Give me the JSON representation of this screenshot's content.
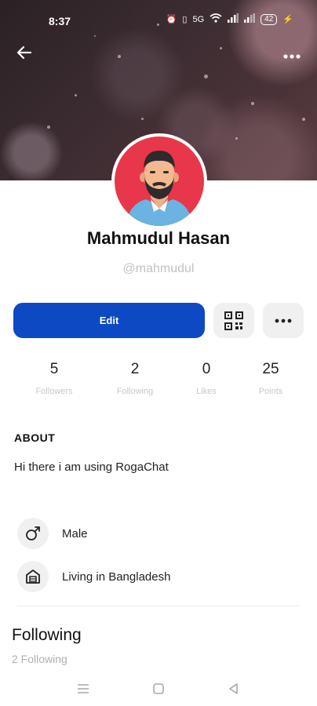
{
  "status_bar": {
    "time": "8:37",
    "network": "5G",
    "battery": "42",
    "icons": [
      "alarm-icon",
      "vibrate-icon",
      "5g-icon",
      "wifi-icon",
      "signal-icon",
      "signal-icon",
      "battery-icon",
      "charging-icon"
    ]
  },
  "header": {
    "back_icon": "arrow-left-icon",
    "more_icon": "more-horizontal-icon"
  },
  "profile": {
    "name": "Mahmudul Hasan",
    "handle": "@mahmudul",
    "avatar_icon": "bearded-man-avatar"
  },
  "actions": {
    "edit_label": "Edit",
    "qr_icon": "qr-code-icon",
    "more_icon": "more-horizontal-icon"
  },
  "stats": [
    {
      "value": "5",
      "label": "Followers"
    },
    {
      "value": "2",
      "label": "Following"
    },
    {
      "value": "0",
      "label": "Likes"
    },
    {
      "value": "25",
      "label": "Points"
    }
  ],
  "about": {
    "title": "ABOUT",
    "text": "Hi there i am using RogaChat"
  },
  "info": [
    {
      "icon": "male-gender-icon",
      "text": "Male"
    },
    {
      "icon": "home-building-icon",
      "text": "Living in Bangladesh"
    }
  ],
  "following": {
    "title": "Following",
    "subtitle": "2 Following"
  },
  "nav": {
    "menu_icon": "menu-icon",
    "home_icon": "square-home-icon",
    "back_icon": "triangle-back-icon"
  },
  "colors": {
    "accent": "#0d49c3",
    "avatar_bg": "#e8374a",
    "muted": "#c2c2c2"
  }
}
